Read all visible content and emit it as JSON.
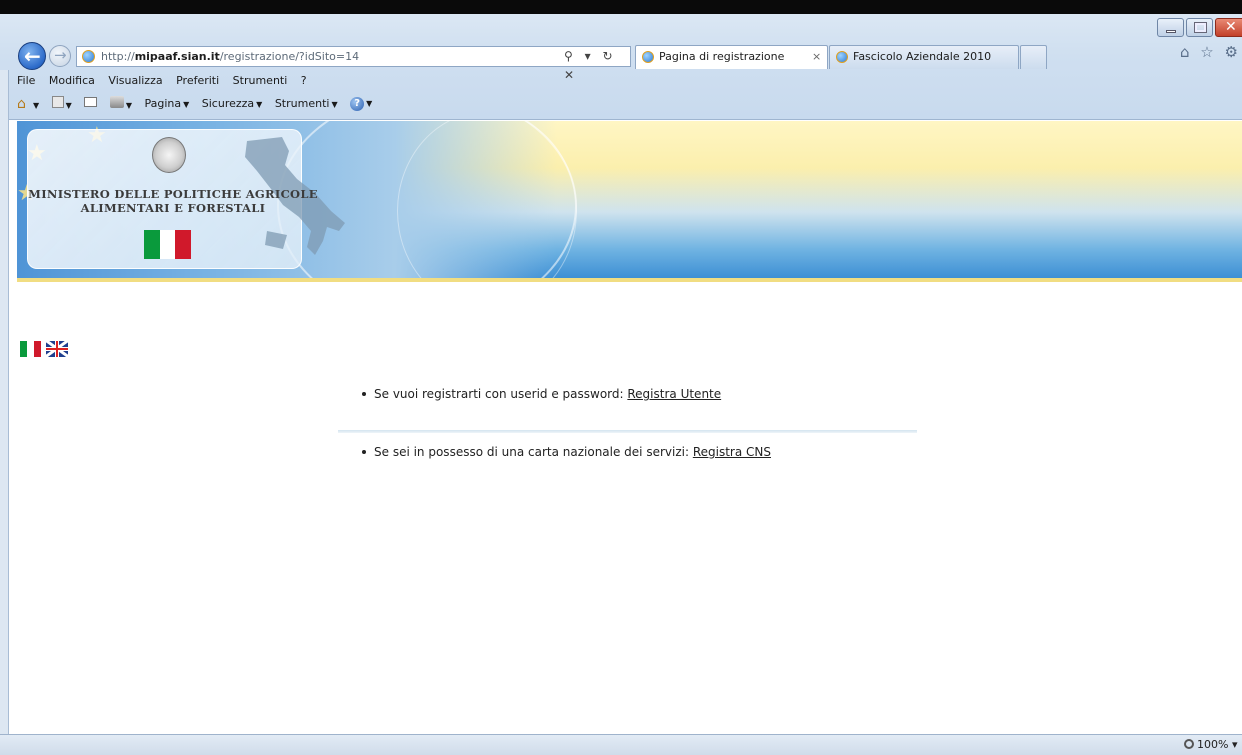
{
  "browser": {
    "address": {
      "prefix": "http://",
      "host": "mipaaf.sian.it",
      "path": "/registrazione/?idSito=14",
      "icons": "⚲ ▾ ↻ ✕"
    },
    "tabs": [
      {
        "label": "Pagina di registrazione",
        "close": "×",
        "active": true
      },
      {
        "label": "Fascicolo Aziendale 2010",
        "active": false
      }
    ],
    "right_icons": "⌂ ☆ ⚙",
    "window_controls": {
      "close_glyph": "✕"
    }
  },
  "menubar": {
    "items": [
      "File",
      "Modifica",
      "Visualizza",
      "Preferiti",
      "Strumenti",
      "?"
    ]
  },
  "commandbar": {
    "items": [
      "Pagina",
      "Sicurezza",
      "Strumenti"
    ],
    "help_glyph": "?"
  },
  "banner": {
    "ministry_line1": "MINISTERO DELLE POLITICHE AGRICOLE",
    "ministry_line2": "ALIMENTARI E FORESTALI",
    "flag_colors": [
      "#0a9a3c",
      "#ffffff",
      "#d0192b"
    ],
    "star_glyph": "★"
  },
  "page": {
    "option_user_text": "Se vuoi registrarti con userid e password: ",
    "option_user_link": "Registra Utente",
    "option_cns_text": "Se sei in possesso di una carta nazionale dei servizi: ",
    "option_cns_link": "Registra CNS"
  },
  "statusbar": {
    "zoom": "100%",
    "zoom_caret": "▾"
  },
  "colors": {
    "chrome": "#cfdff0",
    "accent_blue": "#2c6ac9",
    "banner_yellow": "#fbefad",
    "banner_blue": "#3d8fd4"
  }
}
